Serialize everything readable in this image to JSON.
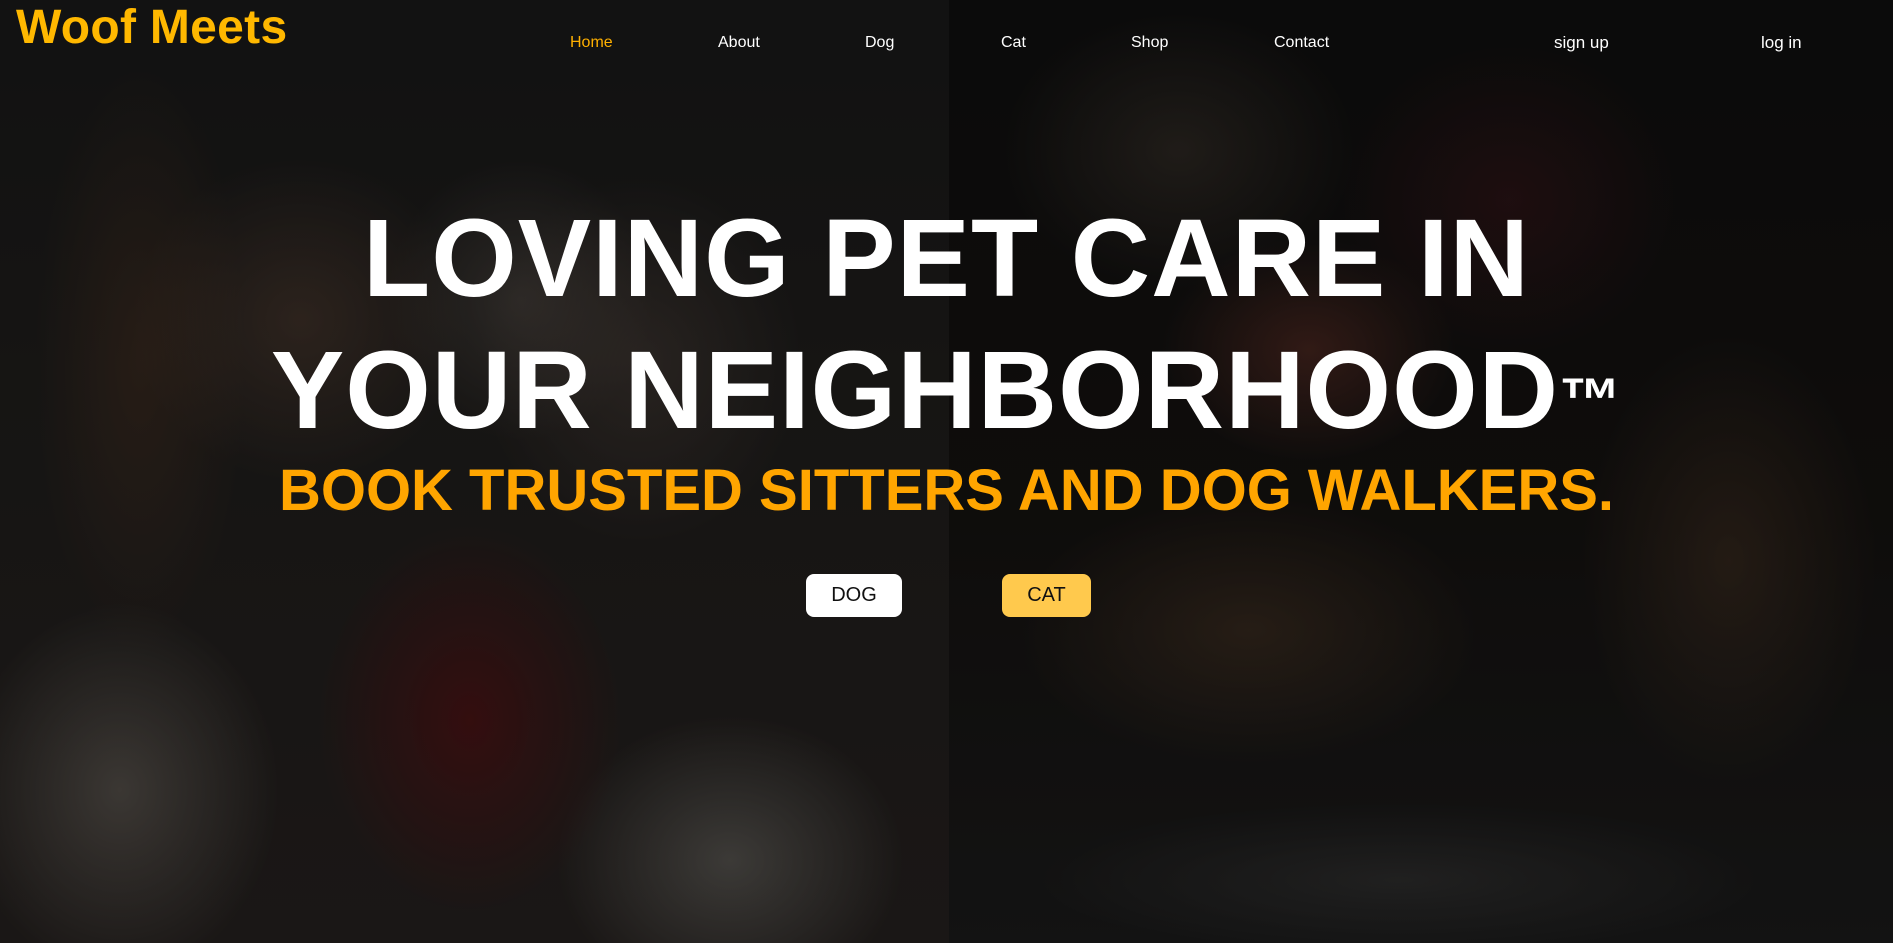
{
  "brand": {
    "name": "Woof Meets",
    "color": "#ffb800"
  },
  "nav": {
    "items": [
      {
        "label": "Home",
        "active": true
      },
      {
        "label": "About",
        "active": false
      },
      {
        "label": "Dog",
        "active": false
      },
      {
        "label": "Cat",
        "active": false
      },
      {
        "label": "Shop",
        "active": false
      },
      {
        "label": "Contact",
        "active": false
      }
    ],
    "signup_label": "sign up",
    "login_label": "log in"
  },
  "hero": {
    "title_line1": "LOVING PET CARE IN",
    "title_line2": "YOUR NEIGHBORHOOD",
    "trademark": "™",
    "subtitle": "BOOK TRUSTED SITTERS AND DOG WALKERS.",
    "dog_button": "DOG",
    "cat_button": "CAT"
  },
  "colors": {
    "accent": "#ffa500",
    "cat_button": "#ffc94d",
    "active_nav": "#ffb000"
  }
}
